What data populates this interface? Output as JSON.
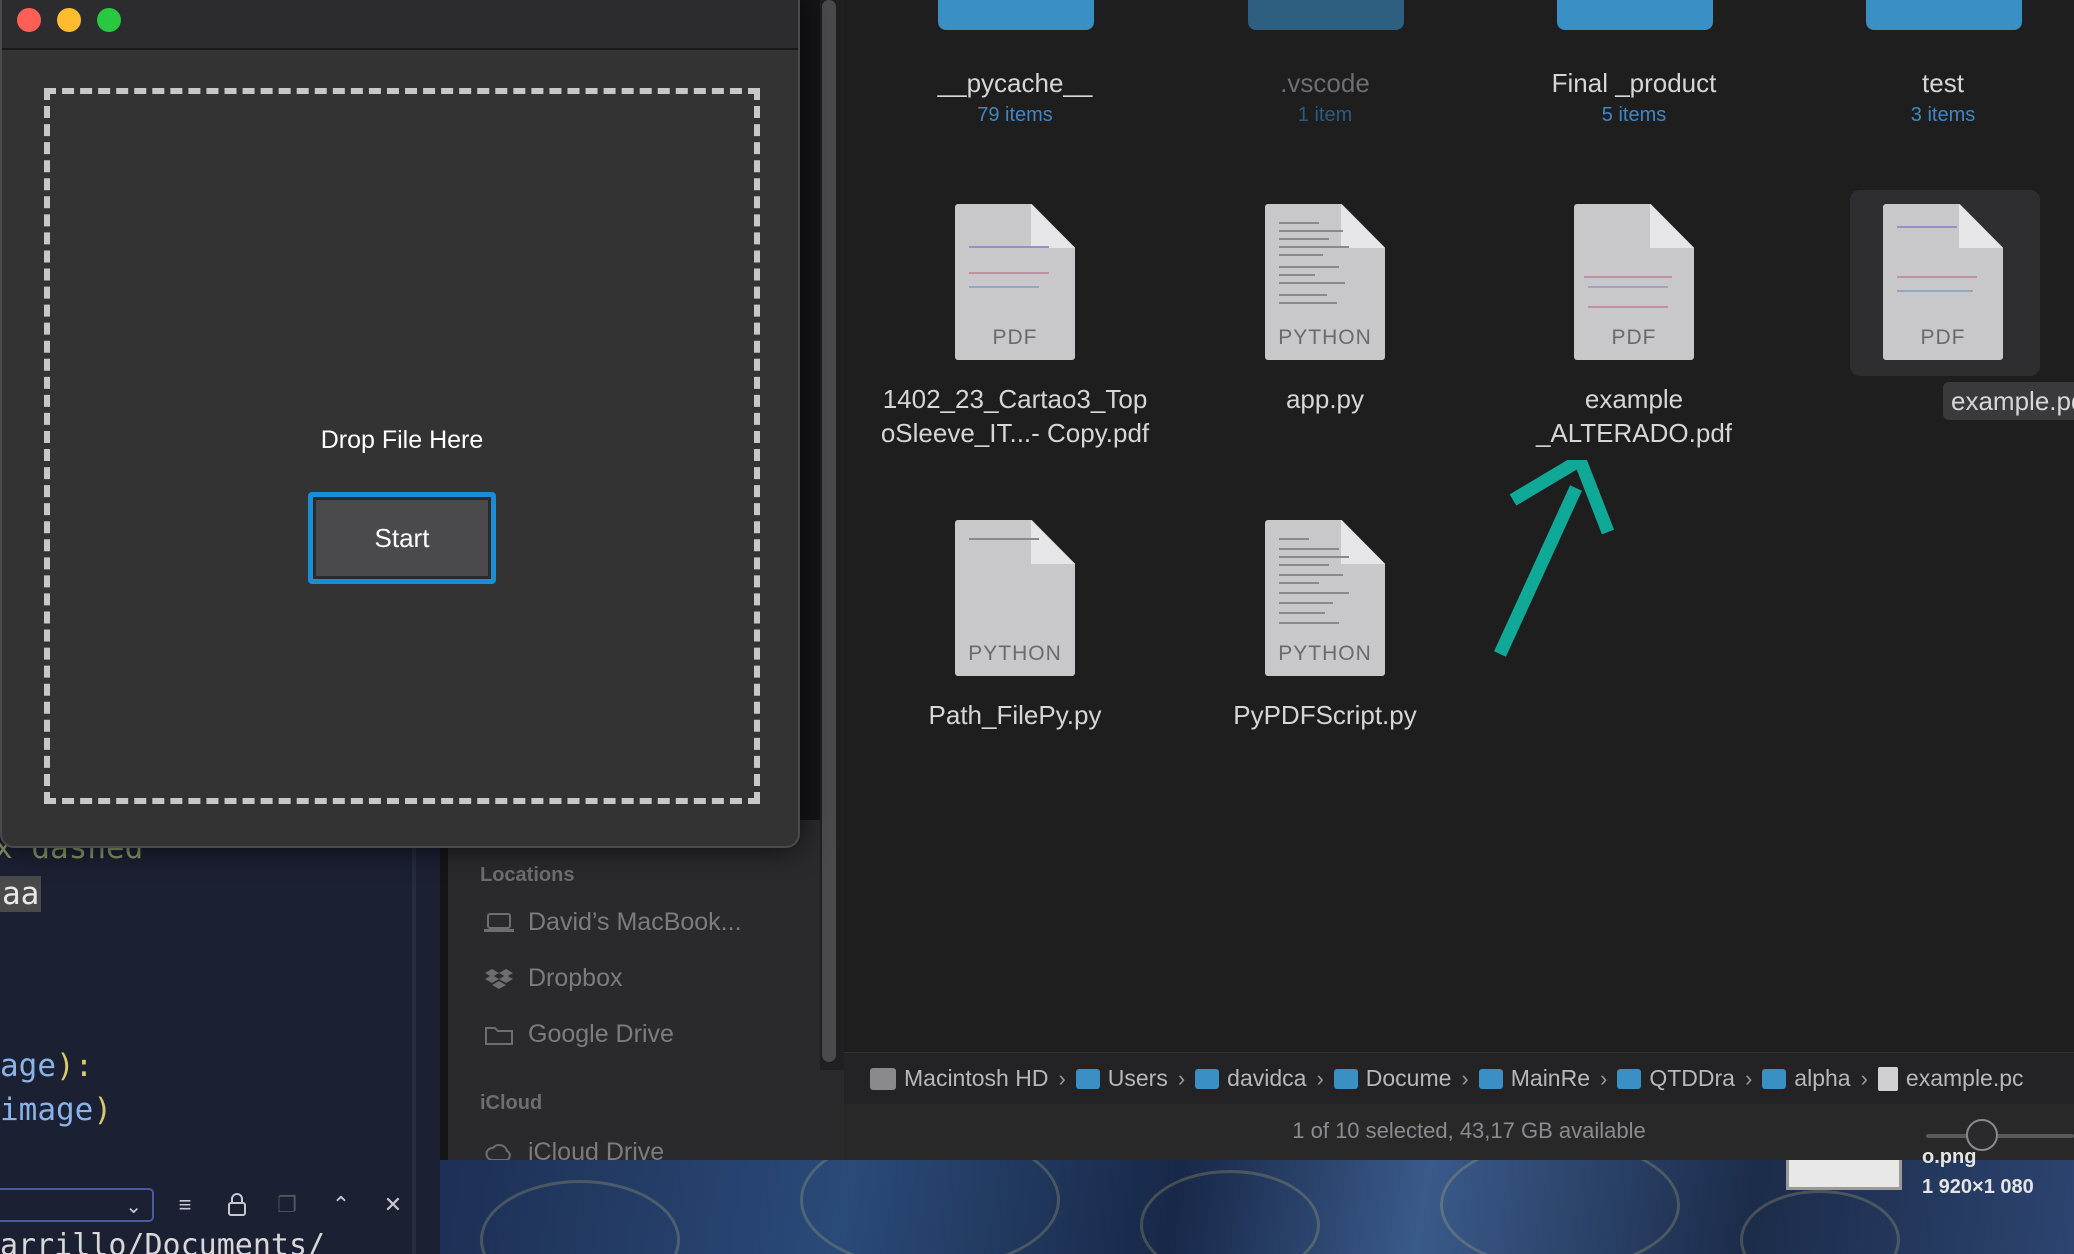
{
  "app_window": {
    "drop_label": "Drop File Here",
    "start_label": "Start"
  },
  "editor": {
    "line1": "x dashed",
    "line2": "aa",
    "line3_text": "age",
    "line3_punct": "):",
    "line4_text": "image",
    "line4_punct": ")",
    "terminal_path": "arrillo/Documents/"
  },
  "sidebar": {
    "locations_header": "Locations",
    "locations": [
      {
        "label": "David’s MacBook...",
        "icon": "laptop-icon"
      },
      {
        "label": "Dropbox",
        "icon": "dropbox-icon"
      },
      {
        "label": "Google Drive",
        "icon": "folder-icon"
      }
    ],
    "icloud_header": "iCloud",
    "icloud_items": [
      {
        "label": "iCloud Drive",
        "icon": "cloud-icon"
      }
    ]
  },
  "finder": {
    "folders": [
      {
        "name": "__pycache__",
        "count": "79 items"
      },
      {
        "name": ".vscode",
        "count": "1 item"
      },
      {
        "name": "Final _product",
        "count": "5 items"
      },
      {
        "name": "test",
        "count": "3 items"
      }
    ],
    "files_row1": [
      {
        "name_line1": "1402_23_Cartao3_Top",
        "name_line2": "oSleeve_IT...- Copy.pdf",
        "type": "PDF"
      },
      {
        "name_line1": "app.py",
        "name_line2": "",
        "type": "PYTHON"
      },
      {
        "name_line1": "example",
        "name_line2": "_ALTERADO.pdf",
        "type": "PDF"
      },
      {
        "name_line1": "example.pdf",
        "name_line2": "",
        "type": "PDF"
      }
    ],
    "files_row2": [
      {
        "name_line1": "Path_FilePy.py",
        "type": "PYTHON"
      },
      {
        "name_line1": "PyPDFScript.py",
        "type": "PYTHON"
      }
    ],
    "selected_file": "example.pdf",
    "path": [
      "Macintosh HD",
      "Users",
      "davidca",
      "Docume",
      "MainRe",
      "QTDDra",
      "alpha",
      "example.pc"
    ],
    "status": "1 of 10 selected, 43,17 GB available",
    "accent_color": "#3a8fc4",
    "arrow_color": "#10a896"
  },
  "desktop": {
    "file_label": "o.png",
    "dimensions": "1 920×1 080"
  }
}
